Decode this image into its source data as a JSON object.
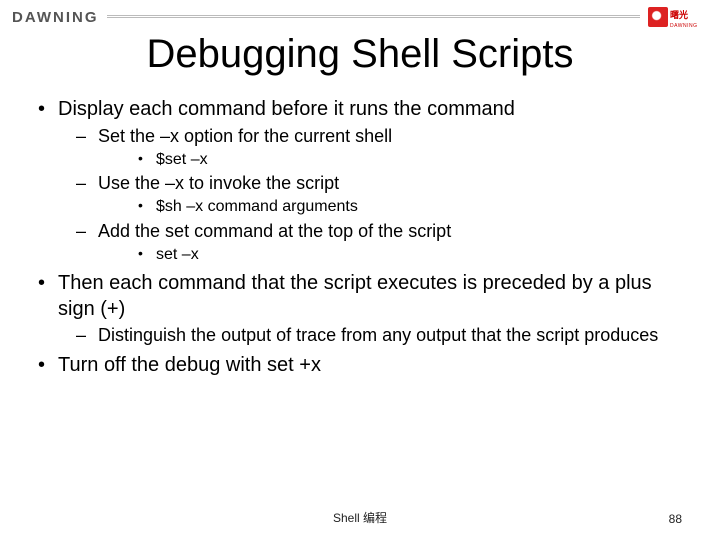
{
  "header": {
    "brand": "DAWNING",
    "logo_text": "曙光",
    "logo_sub": "DAWNING"
  },
  "title": "Debugging Shell Scripts",
  "bullets": {
    "b1_0": "Display each command before it runs the command",
    "b2_0": "Set the –x option for the current shell",
    "b3_0": "$set –x",
    "b2_1": "Use the –x to invoke the script",
    "b3_1": "$sh –x command arguments",
    "b2_2": "Add the set command at the top of the script",
    "b3_2": "set –x",
    "b1_1": "Then each command that the script executes is preceded by a plus sign (+)",
    "b2_3": "Distinguish the output of trace from any output that the script produces",
    "b1_2": "Turn off the debug with set +x"
  },
  "footer": {
    "center": "Shell 编程",
    "page": "88"
  }
}
